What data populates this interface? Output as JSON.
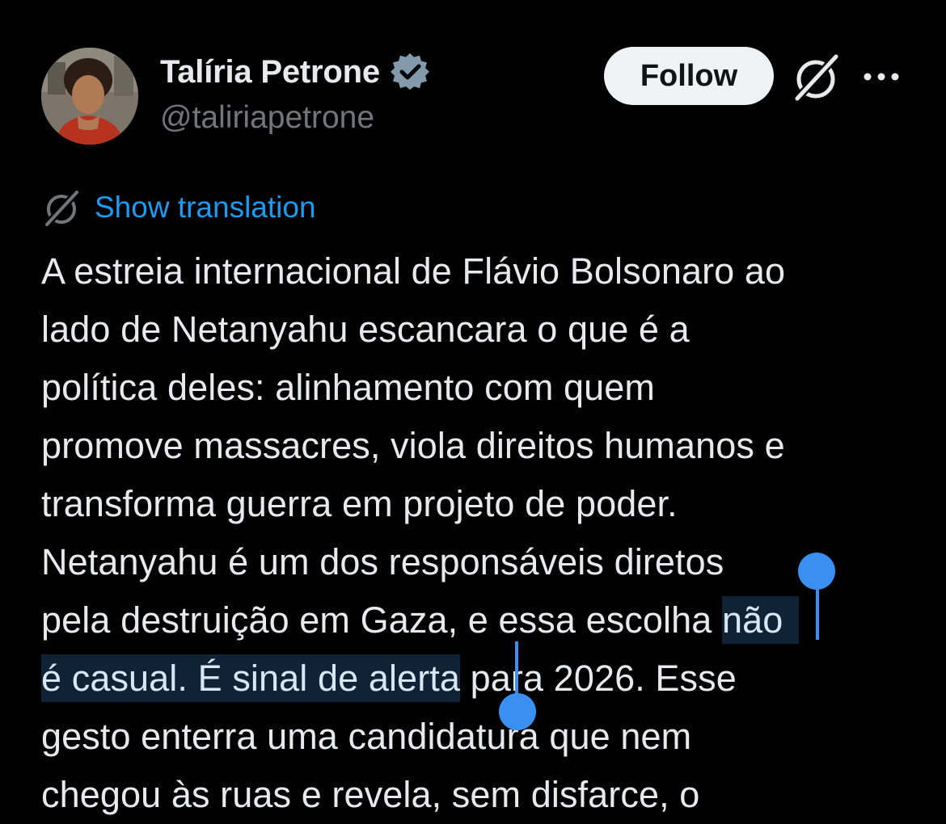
{
  "author": {
    "display_name": "Talíria Petrone",
    "handle": "@taliriapetrone",
    "verified": true
  },
  "actions": {
    "follow_label": "Follow",
    "grok_icon": "grok-icon",
    "more_icon": "more-icon"
  },
  "translation": {
    "link_label": "Show translation"
  },
  "tweet": {
    "lines": [
      "A estreia internacional de Flávio Bolsonaro ao",
      "lado de Netanyahu escancara o que é a",
      "política deles: alinhamento com quem",
      "promove massacres, viola direitos humanos e",
      "transforma guerra em projeto de poder.",
      "Netanyahu é um dos responsáveis diretos",
      {
        "before": "pela destruição em Gaza, e essa escolha ",
        "selected": "não"
      },
      {
        "selected": "é casual. É sinal de alerta",
        "after": " para 2026. Esse"
      },
      "gesto enterra uma candidatura que nem",
      "chegou às ruas e revela, sem disfarce, o"
    ]
  },
  "colors": {
    "background": "#000000",
    "text": "#e7e9ea",
    "secondary_text": "#71767b",
    "link": "#1d9bf0",
    "verified_badge": "#829aab",
    "selection_bg": "#102336",
    "selection_handle": "#3a8ff2",
    "follow_bg": "#eff3f4"
  }
}
